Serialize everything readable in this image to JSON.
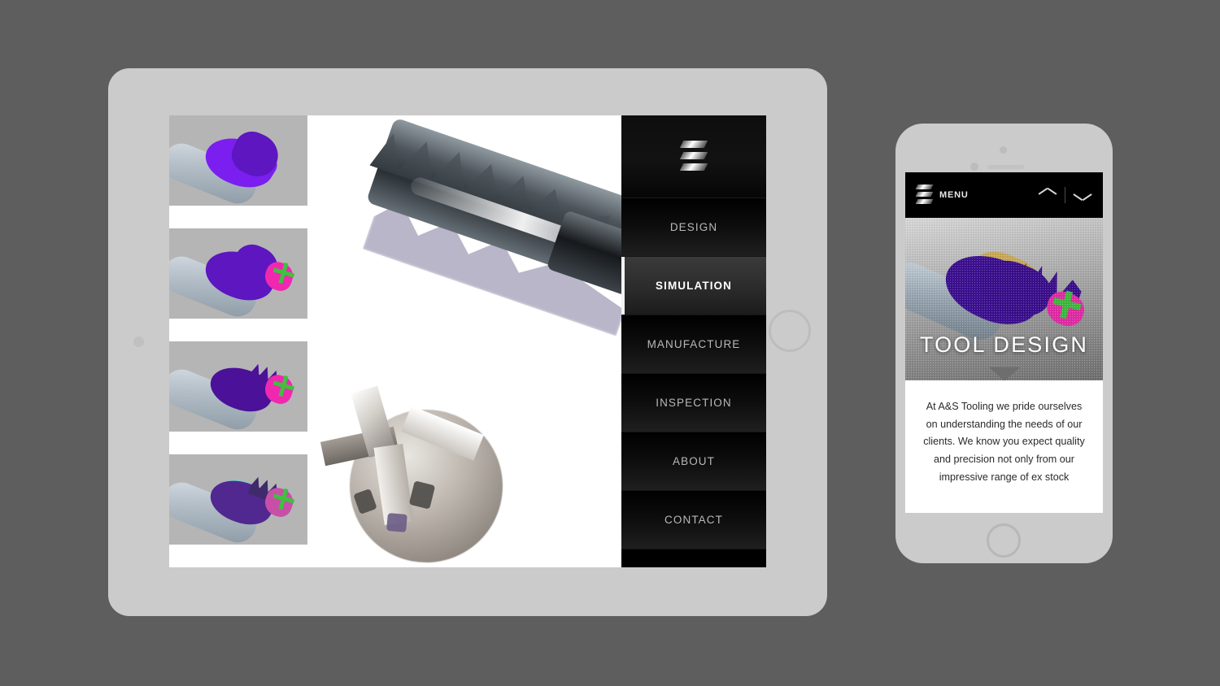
{
  "theme": {
    "page_background": "#5e5e5e",
    "device_bezel": "#cbcbcb",
    "menu_background": "#000000",
    "menu_text": "#b9b9b9",
    "menu_active_text": "#ffffff",
    "accent_purple": "#7a1ff0",
    "accent_magenta": "#f028b0",
    "accent_green": "#3fc03f",
    "accent_gold": "#e8c264"
  },
  "tablet": {
    "name": "tablet-device",
    "thumbnails": [
      {
        "label": "tool-render-step-1",
        "alt": "CAD render of end mill with purple flutes"
      },
      {
        "label": "tool-render-step-2",
        "alt": "CAD render with magenta cutting edges"
      },
      {
        "label": "tool-render-step-3",
        "alt": "CAD render with gold and green axis"
      },
      {
        "label": "tool-render-step-4",
        "alt": "CAD render with teal edge bands"
      }
    ],
    "main_images": [
      {
        "label": "roughing-end-mill-photo",
        "alt": "Photo of serrated roughing end mill"
      },
      {
        "label": "end-mill-tip-photo",
        "alt": "Photo of four flute end mill tip"
      }
    ],
    "menu": {
      "logo_name": "as-tooling-logo",
      "items": [
        {
          "label": "DESIGN",
          "active": false
        },
        {
          "label": "SIMULATION",
          "active": true
        },
        {
          "label": "MANUFACTURE",
          "active": false
        },
        {
          "label": "INSPECTION",
          "active": false
        },
        {
          "label": "ABOUT",
          "active": false
        },
        {
          "label": "CONTACT",
          "active": false
        }
      ]
    }
  },
  "phone": {
    "name": "phone-device",
    "header": {
      "logo_name": "as-tooling-logo",
      "menu_label": "MENU",
      "prev_icon": "chevron-up-icon",
      "next_icon": "chevron-down-icon"
    },
    "hero": {
      "title": "TOOL DESIGN",
      "image_alt": "CAD render of end mill with halftone overlay"
    },
    "body": {
      "paragraph": "At A&S Tooling we pride ourselves on understanding the needs of our clients. We know you expect quality and precision not only from our impressive range of ex stock"
    }
  }
}
